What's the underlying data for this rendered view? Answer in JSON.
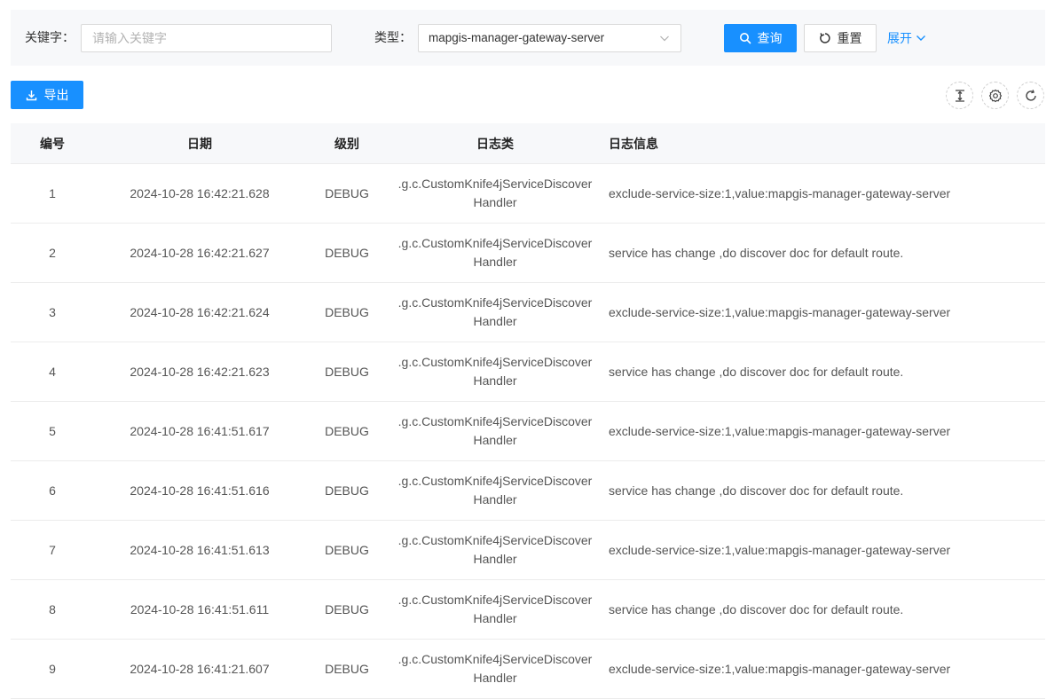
{
  "search": {
    "keyword_label": "关键字：",
    "keyword_placeholder": "请输入关键字",
    "keyword_value": "",
    "type_label": "类型：",
    "type_value": "mapgis-manager-gateway-server",
    "query_label": "查询",
    "reset_label": "重置",
    "expand_label": "展开"
  },
  "toolbar": {
    "export_label": "导出",
    "icons": [
      "column-height-icon",
      "settings-icon",
      "reload-icon"
    ]
  },
  "colors": {
    "primary": "#1890ff",
    "panel_bg": "#f7f8fa",
    "border": "#d9d9d9"
  },
  "table": {
    "columns": [
      "编号",
      "日期",
      "级别",
      "日志类",
      "日志信息"
    ],
    "rows": [
      {
        "no": "1",
        "date": "2024-10-28 16:42:21.628",
        "level": "DEBUG",
        "cls": ".g.c.CustomKnife4jServiceDiscoverHandler",
        "msg": "exclude-service-size:1,value:mapgis-manager-gateway-server"
      },
      {
        "no": "2",
        "date": "2024-10-28 16:42:21.627",
        "level": "DEBUG",
        "cls": ".g.c.CustomKnife4jServiceDiscoverHandler",
        "msg": "service has change ,do discover doc for default route."
      },
      {
        "no": "3",
        "date": "2024-10-28 16:42:21.624",
        "level": "DEBUG",
        "cls": ".g.c.CustomKnife4jServiceDiscoverHandler",
        "msg": "exclude-service-size:1,value:mapgis-manager-gateway-server"
      },
      {
        "no": "4",
        "date": "2024-10-28 16:42:21.623",
        "level": "DEBUG",
        "cls": ".g.c.CustomKnife4jServiceDiscoverHandler",
        "msg": "service has change ,do discover doc for default route."
      },
      {
        "no": "5",
        "date": "2024-10-28 16:41:51.617",
        "level": "DEBUG",
        "cls": ".g.c.CustomKnife4jServiceDiscoverHandler",
        "msg": "exclude-service-size:1,value:mapgis-manager-gateway-server"
      },
      {
        "no": "6",
        "date": "2024-10-28 16:41:51.616",
        "level": "DEBUG",
        "cls": ".g.c.CustomKnife4jServiceDiscoverHandler",
        "msg": "service has change ,do discover doc for default route."
      },
      {
        "no": "7",
        "date": "2024-10-28 16:41:51.613",
        "level": "DEBUG",
        "cls": ".g.c.CustomKnife4jServiceDiscoverHandler",
        "msg": "exclude-service-size:1,value:mapgis-manager-gateway-server"
      },
      {
        "no": "8",
        "date": "2024-10-28 16:41:51.611",
        "level": "DEBUG",
        "cls": ".g.c.CustomKnife4jServiceDiscoverHandler",
        "msg": "service has change ,do discover doc for default route."
      },
      {
        "no": "9",
        "date": "2024-10-28 16:41:21.607",
        "level": "DEBUG",
        "cls": ".g.c.CustomKnife4jServiceDiscoverHandler",
        "msg": "exclude-service-size:1,value:mapgis-manager-gateway-server"
      }
    ]
  }
}
